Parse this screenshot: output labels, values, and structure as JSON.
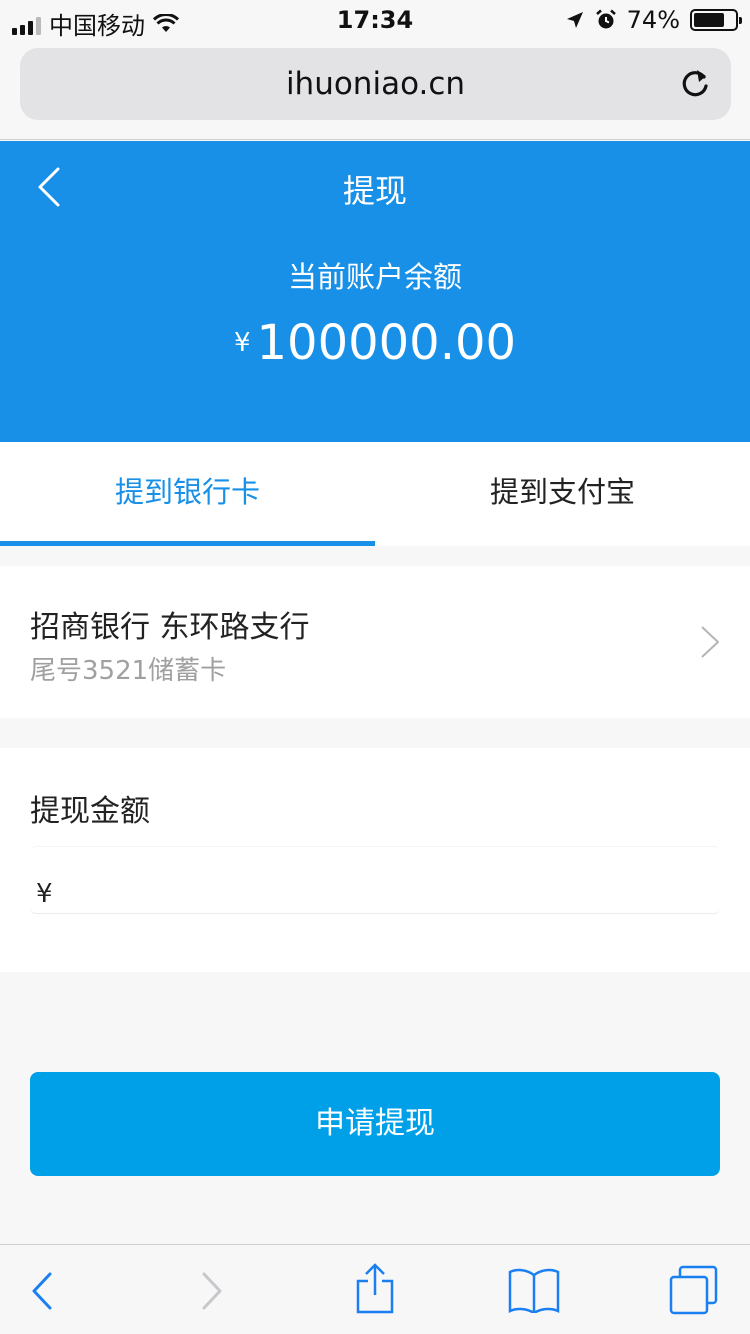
{
  "status_bar": {
    "carrier": "中国移动",
    "time": "17:34",
    "battery_percent": "74%",
    "battery_level": 0.74
  },
  "browser": {
    "url": "ihuoniao.cn"
  },
  "header": {
    "title": "提现",
    "balance_label": "当前账户余额",
    "currency_symbol": "¥",
    "balance": "100000.00",
    "color": "#1890e8"
  },
  "tabs": [
    {
      "label": "提到银行卡",
      "active": true
    },
    {
      "label": "提到支付宝",
      "active": false
    }
  ],
  "bank_card": {
    "name": "招商银行 东环路支行",
    "subtitle": "尾号3521储蓄卡"
  },
  "amount": {
    "label": "提现金额",
    "currency_symbol": "¥",
    "value": "",
    "placeholder": ""
  },
  "submit": {
    "label": "申请提现",
    "color": "#00a0e8"
  },
  "toolbar": {
    "icons": [
      "back-icon",
      "forward-icon",
      "share-icon",
      "bookmarks-icon",
      "tabs-icon"
    ]
  }
}
